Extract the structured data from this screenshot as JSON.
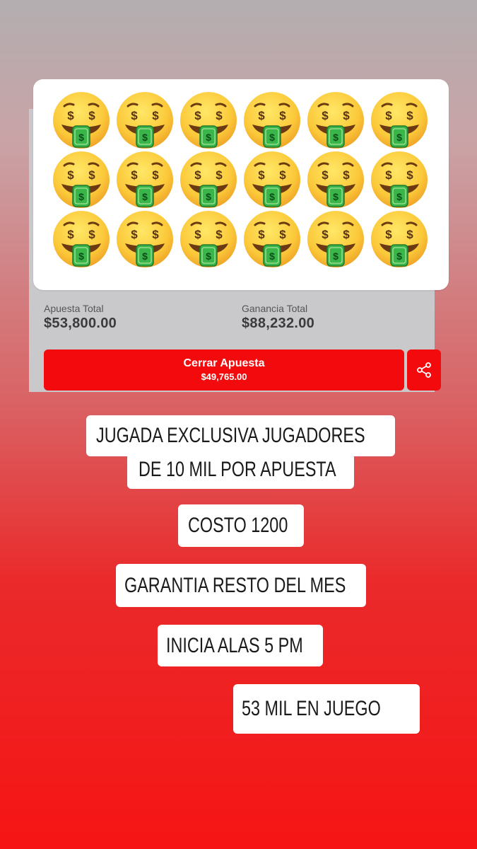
{
  "emojis": {
    "icon": "money-mouth-face-icon",
    "rows": 3,
    "cols": 6
  },
  "totals": {
    "stake_label": "Apuesta Total",
    "stake_value": "$53,800.00",
    "winnings_label": "Ganancia Total",
    "winnings_value": "$88,232.00"
  },
  "close_bet": {
    "label": "Cerrar Apuesta",
    "amount": "$49,765.00"
  },
  "share": {
    "icon": "share-icon"
  },
  "tags": {
    "line1": "JUGADA EXCLUSIVA JUGADORES",
    "line2": "DE 10 MIL POR APUESTA",
    "cost": "COSTO 1200",
    "guarantee": "GARANTIA RESTO DEL MES",
    "start": "INICIA ALAS 5 PM",
    "at_stake": "53 MIL EN JUEGO"
  },
  "colors": {
    "accent_red": "#f20a0c",
    "panel_gray": "#c9c9cc"
  }
}
